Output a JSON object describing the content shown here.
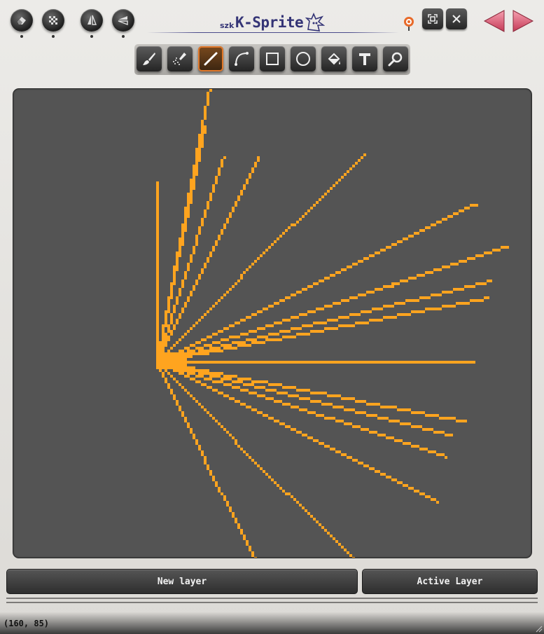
{
  "app": {
    "logo_prefix": "szk",
    "logo_name": "K-Sprite"
  },
  "header": {
    "left_buttons": [
      {
        "icon": "eraser-icon"
      },
      {
        "icon": "dither-pattern-icon"
      },
      {
        "icon": "mirror-vertical-icon"
      },
      {
        "icon": "mirror-horizontal-icon"
      }
    ],
    "right_buttons": [
      {
        "icon": "fit-view-icon"
      },
      {
        "icon": "close-icon"
      }
    ],
    "nav": [
      {
        "icon": "arrow-left-icon"
      },
      {
        "icon": "arrow-right-icon"
      }
    ]
  },
  "toolbar": {
    "active_tool": "line",
    "tools": [
      {
        "id": "brush",
        "icon": "brush-icon"
      },
      {
        "id": "spray",
        "icon": "spray-icon"
      },
      {
        "id": "line",
        "icon": "line-icon"
      },
      {
        "id": "curve",
        "icon": "curve-icon"
      },
      {
        "id": "rectangle",
        "icon": "rectangle-icon"
      },
      {
        "id": "ellipse",
        "icon": "ellipse-icon"
      },
      {
        "id": "fill",
        "icon": "fill-bucket-icon"
      },
      {
        "id": "text",
        "icon": "text-icon"
      },
      {
        "id": "zoom",
        "icon": "magnifier-icon"
      }
    ]
  },
  "colors": {
    "stroke": "#ffa41f",
    "canvas_bg": "#545454",
    "accent": "#e0782a",
    "nav_arrow": "#e0506a"
  },
  "buttons": {
    "new_layer": "New layer",
    "active_layer": "Active Layer"
  },
  "status": {
    "cursor": "(160, 85)"
  }
}
